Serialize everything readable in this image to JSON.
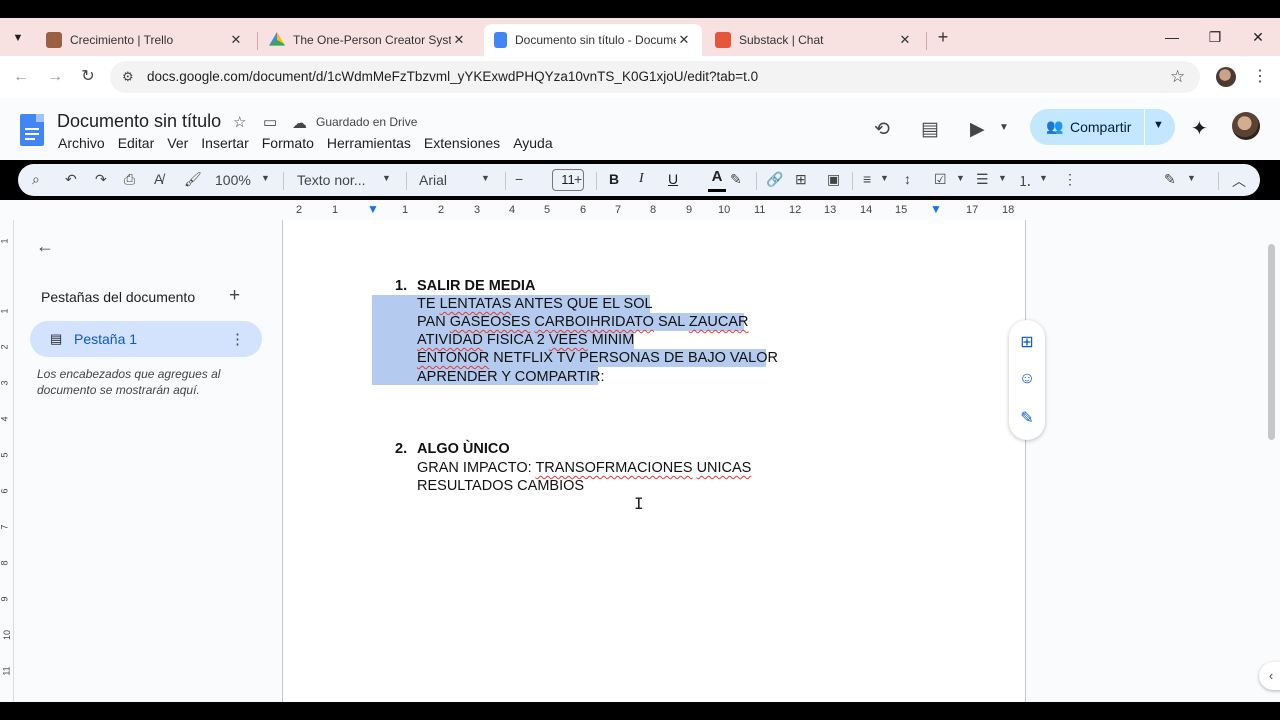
{
  "browser": {
    "tabs": [
      {
        "title": "Crecimiento | Trello",
        "color": "#9b5f44"
      },
      {
        "title": "The One-Person Creator System",
        "color": "#34a853"
      },
      {
        "title": "Documento sin título - Docume",
        "color": "#4285f4"
      },
      {
        "title": "Substack | Chat",
        "color": "#e8563a"
      }
    ],
    "active_tab": 2,
    "url": "docs.google.com/document/d/1cWdmMeFzTbzvml_yYKExwdPHQYza10vnTS_K0G1xjoU/edit?tab=t.0"
  },
  "doc": {
    "title": "Documento sin título",
    "saved_status": "Guardado en Drive",
    "menu": [
      "Archivo",
      "Editar",
      "Ver",
      "Insertar",
      "Formato",
      "Herramientas",
      "Extensiones",
      "Ayuda"
    ],
    "share_label": "Compartir"
  },
  "toolbar": {
    "zoom": "100%",
    "style": "Texto nor...",
    "font": "Arial",
    "font_size": "11"
  },
  "ruler": {
    "h_ticks": [
      "2",
      "1",
      "1",
      "2",
      "3",
      "4",
      "5",
      "6",
      "7",
      "8",
      "9",
      "10",
      "11",
      "12",
      "13",
      "14",
      "15",
      "16",
      "17",
      "18"
    ],
    "v_ticks": [
      "1",
      "1",
      "2",
      "3",
      "4",
      "5",
      "6",
      "7",
      "8",
      "9",
      "10",
      "11"
    ]
  },
  "sidebar": {
    "title": "Pestañas del documento",
    "tab_label": "Pestaña 1",
    "hint": "Los encabezados que agregues al documento se mostrarán aquí."
  },
  "content": {
    "item1": {
      "number": "1.",
      "heading": "SALIR DE MEDIA",
      "lines": [
        "TE LENTATAS ANTES QUE EL SOL",
        "PAN GASEOSES CARBOIHRIDATO SAL ZAUCAR",
        "ATIVIDAD FISICA 2 VEES MINIM",
        "ENTONOR NETFLIX TV PERSONAS DE BAJO VALOR",
        "APRENDER Y COMPARTIR:"
      ]
    },
    "item2": {
      "number": "2.",
      "heading": "ALGO ÙNICO",
      "lines": [
        "GRAN IMPACTO: TRANSOFRMACIONES UNICAS",
        "RESULTADOS CAMBIOS"
      ]
    }
  }
}
